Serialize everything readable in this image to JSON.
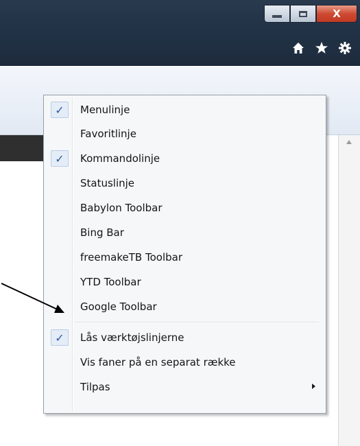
{
  "window": {
    "buttons": [
      {
        "name": "minimize",
        "icon": "minimize-icon"
      },
      {
        "name": "maximize",
        "icon": "maximize-icon"
      },
      {
        "name": "close",
        "icon": "close-icon",
        "glyph": "X"
      }
    ],
    "nav_icons": [
      "home-icon",
      "star-icon",
      "gear-icon"
    ]
  },
  "menu": {
    "items": [
      {
        "label": "Menulinje",
        "checked": true
      },
      {
        "label": "Favoritlinje",
        "checked": false
      },
      {
        "label": "Kommandolinje",
        "checked": true
      },
      {
        "label": "Statuslinje",
        "checked": false
      },
      {
        "label": "Babylon Toolbar",
        "checked": false
      },
      {
        "label": "Bing Bar",
        "checked": false
      },
      {
        "label": "freemakeTB Toolbar",
        "checked": false
      },
      {
        "label": "YTD Toolbar",
        "checked": false
      },
      {
        "label": "Google Toolbar",
        "checked": false
      },
      {
        "label": "Lås værktøjslinjerne",
        "checked": true
      },
      {
        "label": "Vis faner på en separat række",
        "checked": false
      },
      {
        "label": "Tilpas",
        "checked": false,
        "has_submenu": true
      }
    ],
    "check_glyph": "✓"
  },
  "colors": {
    "titlebar": "#223246",
    "check": "#2c5aa0",
    "close_button": "#cf4a32"
  }
}
